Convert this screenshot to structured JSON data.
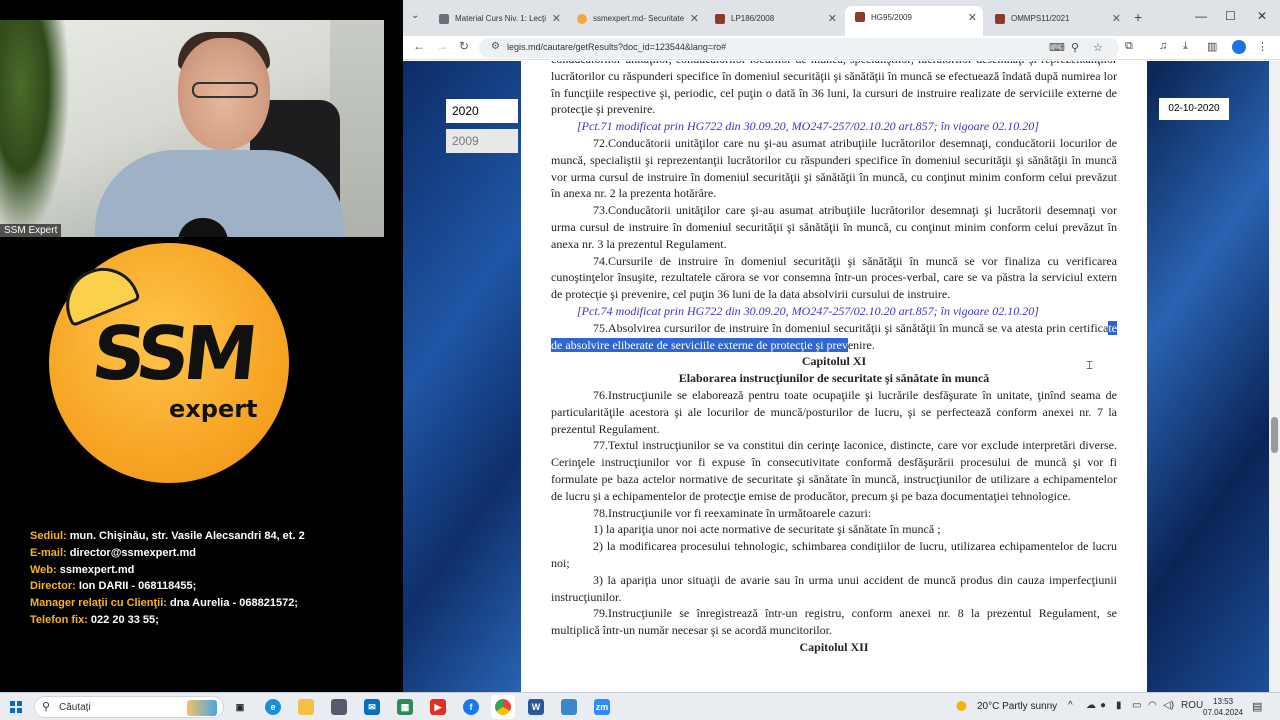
{
  "left_panel": {
    "webcam_label": "SSM Expert",
    "logo": {
      "main": "SSM",
      "sub": "expert"
    },
    "contacts": [
      {
        "key": "Sediul:",
        "value": " mun. Chişinău, str. Vasile Alecsandri 84, et. 2"
      },
      {
        "key": "E-mail:",
        "value": " director@ssmexpert.md"
      },
      {
        "key": "Web:",
        "value": " ssmexpert.md"
      },
      {
        "key": "Director:",
        "value": " Ion DARII - 068118455;"
      },
      {
        "key": "Manager relaţii cu Clienţii:",
        "value": " dna Aurelia - 068821572;"
      },
      {
        "key": "Telefon fix:",
        "value": " 022 20 33 55;"
      }
    ]
  },
  "browser": {
    "tabs": [
      {
        "label": "Material Curs Niv. 1: Lecţi",
        "color": "#6b7078"
      },
      {
        "label": "ssmexpert.md- Securitate",
        "color": "#f2a73b"
      },
      {
        "label": "LP186/2008",
        "color": "#8b3a2b"
      },
      {
        "label": "HG95/2009",
        "color": "#8b3a2b"
      },
      {
        "label": "OMMPS11/2021",
        "color": "#8b3a2b"
      }
    ],
    "url": "legis.md/cautare/getResults?doc_id=123544&lang=ro#"
  },
  "page": {
    "years": [
      "2020",
      "2009"
    ],
    "date_badge": "02-10-2020",
    "doc": {
      "p0": "conducătorilor unităţilor, conducătorilor locurilor de muncă, specialiştilor, lucrătorilor desemnaţi şi reprezentanţilor lucrătorilor cu răspunderi specifice în domeniul securităţii şi sănătăţii în muncă se efectuează îndată după numirea lor în funcţiile respective şi, periodic, cel puţin o dată în 36 luni, la cursuri de instruire realizate de serviciile externe de protecţie şi prevenire.",
      "mod71": "[Pct.71 modificat prin HG722 din 30.09.20, MO247-257/02.10.20 art.857; în vigoare 02.10.20]",
      "p72": "72.Conducătorii unităţilor care nu şi-au asumat atribuţiile lucrătorilor desemnaţi, conducătorii locurilor de muncă, specialiştii şi reprezentanţii lucrătorilor cu răspunderi specifice în domeniul securităţii şi sănătăţii în muncă vor urma cursul de instruire în domeniul securităţii şi sănătăţii în muncă, cu conţinut minim conform celui prevăzut în anexa nr. 2 la prezenta hotărâre.",
      "p73": "73.Conducătorii unităţilor care şi-au asumat atribuţiile lucrătorilor desemnaţi şi lucrătorii desemnaţi vor urma cursul de instruire în domeniul securităţii şi sănătăţii în muncă, cu conţinut minim conform celui prevăzut în anexa nr. 3 la prezentul Regulament.",
      "p74": "74.Cursurile de instruire în domeniul securităţii şi sănătăţii în muncă se vor finaliza cu verificarea cunoştinţelor însuşite, rezultatele cărora se vor consemna într-un proces-verbal, care se va păstra la serviciul extern de protecţie şi prevenire, cel puţin 36 luni de la data absolvirii cursului de instruire.",
      "mod74": "[Pct.74 modificat prin HG722 din 30.09.20, MO247-257/02.10.20 art.857; în vigoare 02.10.20]",
      "p75a": "75.Absolvirea cursurilor de instruire în domeniul securităţii şi sănătăţii în muncă se va atesta prin certifica",
      "p75hl": "te de absolvire eliberate de serviciile externe de protecţie şi prev",
      "p75b": "enire.",
      "chap11": "Capitolul XI",
      "chap11_title": "Elaborarea instrucţiunilor de securitate şi sănătate în muncă",
      "p76": "76.Instrucţiunile se elaborează pentru toate ocupaţiile şi lucrările desfăşurate în unitate, ţinînd seama de particularităţile acestora şi ale locurilor de muncă/posturilor de lucru, şi se perfectează conform anexei nr. 7 la prezentul Regulament.",
      "p77": "77.Textul instrucţiunilor se va constitui din cerinţe laconice, distincte, care vor exclude interpretări diverse. Cerinţele instrucţiunilor vor fi expuse în consecutivitate conformă desfăşurării procesului de muncă şi vor fi formulate pe baza actelor normative de securitate şi sănătate în muncă, instrucţiunilor de utilizare a echipamentelor de lucru şi a echipamentelor de protecţie emise de producător, precum şi pe baza documentaţiei tehnologice.",
      "p78": "78.Instrucţiunile vor fi reexaminate în următoarele cazuri:",
      "p78_1": "1) la apariţia unor noi acte normative de securitate şi sănătate în muncă ;",
      "p78_2": "2) la modificarea procesului tehnologic, schimbarea condiţiilor de lucru, utilizarea echipamentelor de lucru noi;",
      "p78_3": "3) la apariţia unor situaţii de avarie sau în urma unui accident de muncă produs din cauza imperfecţiunii instrucţiunilor.",
      "p79": "79.Instrucţiunile se înregistrează într-un registru, conform anexei nr. 8 la prezentul Regulament, se multiplică într-un număr necesar şi se acordă muncitorilor.",
      "chap12": "Capitolul XII"
    }
  },
  "taskbar": {
    "search_placeholder": "Căutați",
    "weather": "20°C  Partly sunny",
    "lang": "ROU",
    "time": "13:53",
    "date": "07.04.2024"
  }
}
